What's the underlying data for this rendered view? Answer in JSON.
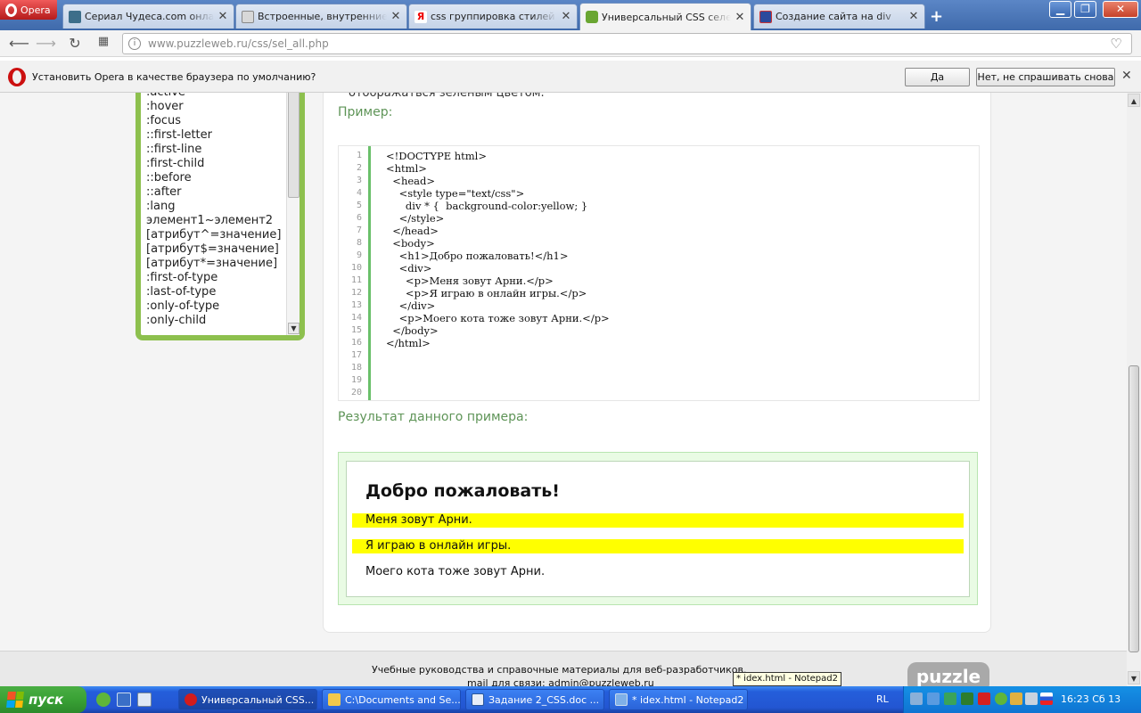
{
  "browser": {
    "menu_label": "Opera",
    "tabs": [
      {
        "title": "Сериал Чудеса.com онлайн",
        "active": false
      },
      {
        "title": "Встроенные, внутренние и",
        "active": false
      },
      {
        "title": "css группировка стилей — Я",
        "active": false
      },
      {
        "title": "Универсальный CSS селект",
        "active": true
      },
      {
        "title": "Создание сайта на div",
        "active": false
      }
    ],
    "new_tab": "+",
    "window_buttons": {
      "minimize": "▁",
      "maximize": "❐",
      "close": "✕"
    },
    "url_host": "www.puzzleweb.ru",
    "url_path": "/css/sel_all.php"
  },
  "notification": {
    "text": "Установить Opera в качестве браузера по умолчанию?",
    "yes": "Да",
    "no": "Нет, не спрашивать снова",
    "close": "✕"
  },
  "sidebar": {
    "items": [
      ":active",
      ":hover",
      ":focus",
      "::first-letter",
      "::first-line",
      ":first-child",
      "::before",
      "::after",
      ":lang",
      "элемент1~элемент2",
      "[атрибут^=значение]",
      "[атрибут$=значение]",
      "[атрибут*=значение]",
      ":first-of-type",
      ":last-of-type",
      ":only-of-type",
      ":only-child"
    ]
  },
  "content": {
    "cut_text": "отображаться зеленым цветом.",
    "example_heading": "Пример:",
    "line_numbers": [
      "1",
      "2",
      "3",
      "4",
      "5",
      "6",
      "7",
      "8",
      "9",
      "10",
      "11",
      "12",
      "13",
      "14",
      "15",
      "16",
      "17",
      "18",
      "19",
      "20"
    ],
    "code": [
      "<!DOCTYPE html>",
      "<html>",
      "  <head>",
      "    <style type=\"text/css\">",
      "      div * {  background-color:yellow; }",
      "    </style>",
      "  </head>",
      "  <body>",
      "",
      "    <h1>Добро пожаловать!</h1>",
      "",
      "    <div>",
      "      <p>Меня зовут Арни.</p>",
      "      <p>Я играю в онлайн игры.</p>",
      "    </div>",
      "",
      "    <p>Моего кота тоже зовут Арни.</p>",
      "",
      "  </body>",
      "</html>"
    ],
    "result_heading": "Результат данного примера:",
    "result": {
      "h1": "Добро пожаловать!",
      "p1": "Меня зовут Арни.",
      "p2": "Я играю в онлайн игры.",
      "p3": "Моего кота тоже зовут Арни."
    }
  },
  "footer": {
    "line1": "Учебные руководства и справочные материалы для веб-разработчиков.",
    "line2": "mail для связи: admin@puzzleweb.ru",
    "logo": "puzzle"
  },
  "tooltip": "* idex.html - Notepad2",
  "taskbar": {
    "start": "пуск",
    "tasks": [
      {
        "label": "Универсальный CSS...",
        "active": true
      },
      {
        "label": "C:\\Documents and Se...",
        "active": false
      },
      {
        "label": "Задание 2_CSS.doc ...",
        "active": false
      },
      {
        "label": "* idex.html - Notepad2",
        "active": false
      }
    ],
    "language": "RL",
    "clock": "16:23 Сб 13"
  },
  "colors": {
    "accent_green": "#8dc04e",
    "heading_green": "#5e9457",
    "highlight_yellow": "#ffff00",
    "taskbar_blue": "#245edb"
  }
}
